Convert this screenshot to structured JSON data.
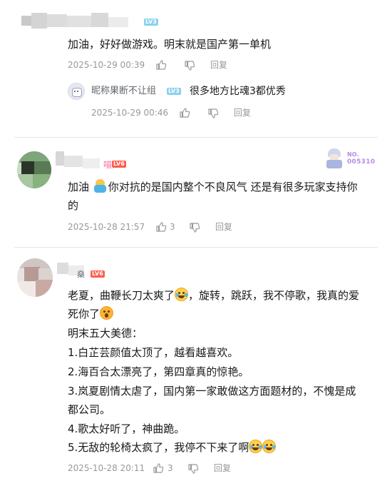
{
  "comments": [
    {
      "user": {
        "name": "",
        "level": "LV3"
      },
      "text": "加油，好好做游戏。明末就是国产第一单机",
      "time": "2025-10-29 00:39",
      "likes": "",
      "reply_label": "回复",
      "replies": [
        {
          "user": {
            "name": "昵称果断不让组",
            "level": "LV3"
          },
          "text": "很多地方比魂3都优秀",
          "time": "2025-10-29 00:46",
          "likes": "",
          "reply_label": "回复"
        }
      ]
    },
    {
      "user": {
        "name": "喵",
        "level": "LV6"
      },
      "badge_label": "NO.",
      "badge_number": "005310",
      "text_pre": "加油",
      "text_post": "你对抗的是国内整个不良风气 还是有很多玩家支持你",
      "text_line2": "的",
      "time": "2025-10-28 21:57",
      "likes": "3",
      "reply_label": "回复"
    },
    {
      "user": {
        "name": "燊",
        "level": "LV6"
      },
      "lines": {
        "l1a": "老夏，曲鞭长刀太爽了",
        "l1b": "，旋转，跳跃，我不停歌，我真的爱",
        "l2a": "死你了",
        "l3": "明末五大美德：",
        "l4": "1.白芷芸颜值太顶了，越看越喜欢。",
        "l5": "2.海百合太漂亮了，第四章真的惊艳。",
        "l6": "3.岚夏剧情太虐了，国内第一家敢做这方面题材的，不愧是成",
        "l7": "都公司。",
        "l8": "4.歌太好听了，神曲跪。",
        "l9": "5.无敌的轮椅太疯了，我停不下来了啊"
      },
      "time": "2025-10-28 20:11",
      "likes": "3",
      "reply_label": "回复"
    }
  ],
  "icons": [
    "thumb-up-icon",
    "thumb-down-icon"
  ]
}
